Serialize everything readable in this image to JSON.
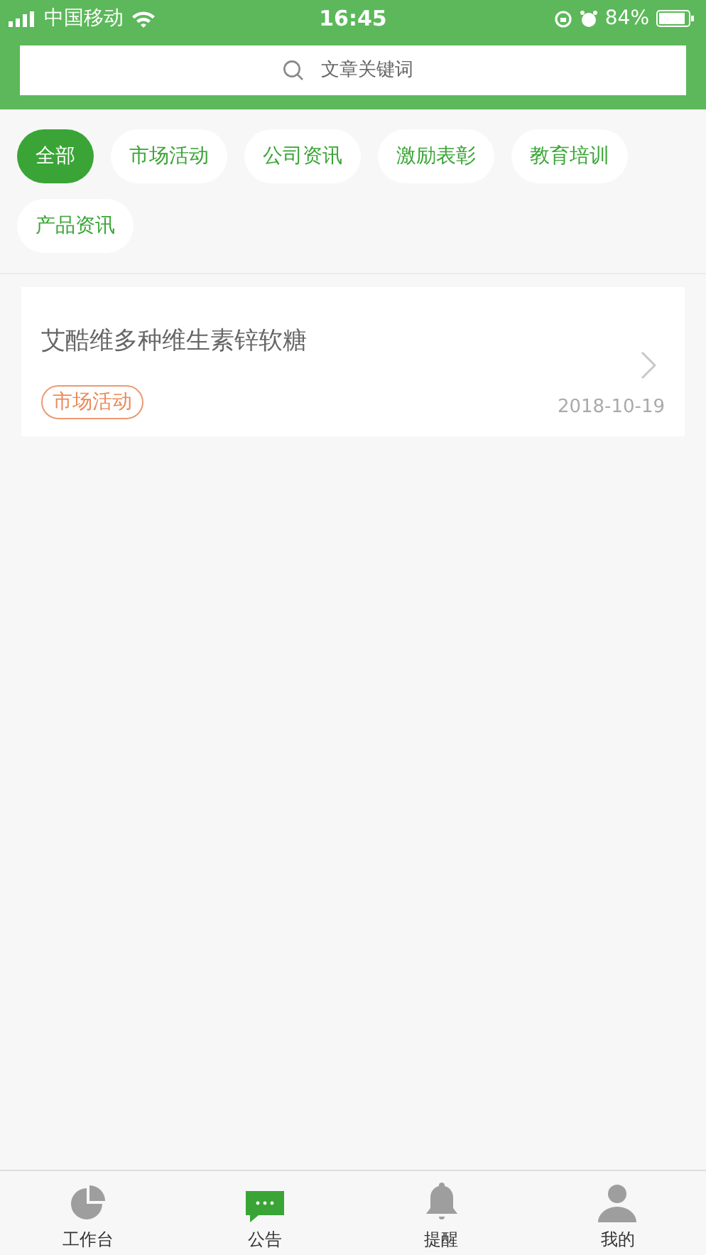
{
  "status_bar": {
    "carrier": "中国移动",
    "time": "16:45",
    "battery": "84%"
  },
  "search": {
    "placeholder": "文章关键词"
  },
  "categories": [
    {
      "label": "全部",
      "selected": true
    },
    {
      "label": "市场活动",
      "selected": false
    },
    {
      "label": "公司资讯",
      "selected": false
    },
    {
      "label": "激励表彰",
      "selected": false
    },
    {
      "label": "教育培训",
      "selected": false
    },
    {
      "label": "产品资讯",
      "selected": false
    }
  ],
  "articles": [
    {
      "title": "艾酷维多种维生素锌软糖",
      "tag": "市场活动",
      "date": "2018-10-19"
    }
  ],
  "tab_bar": [
    {
      "label": "工作台",
      "kind": "dashboard",
      "selected": false
    },
    {
      "label": "公告",
      "kind": "notice",
      "selected": true
    },
    {
      "label": "提醒",
      "kind": "reminder",
      "selected": false
    },
    {
      "label": "我的",
      "kind": "profile",
      "selected": false
    }
  ]
}
